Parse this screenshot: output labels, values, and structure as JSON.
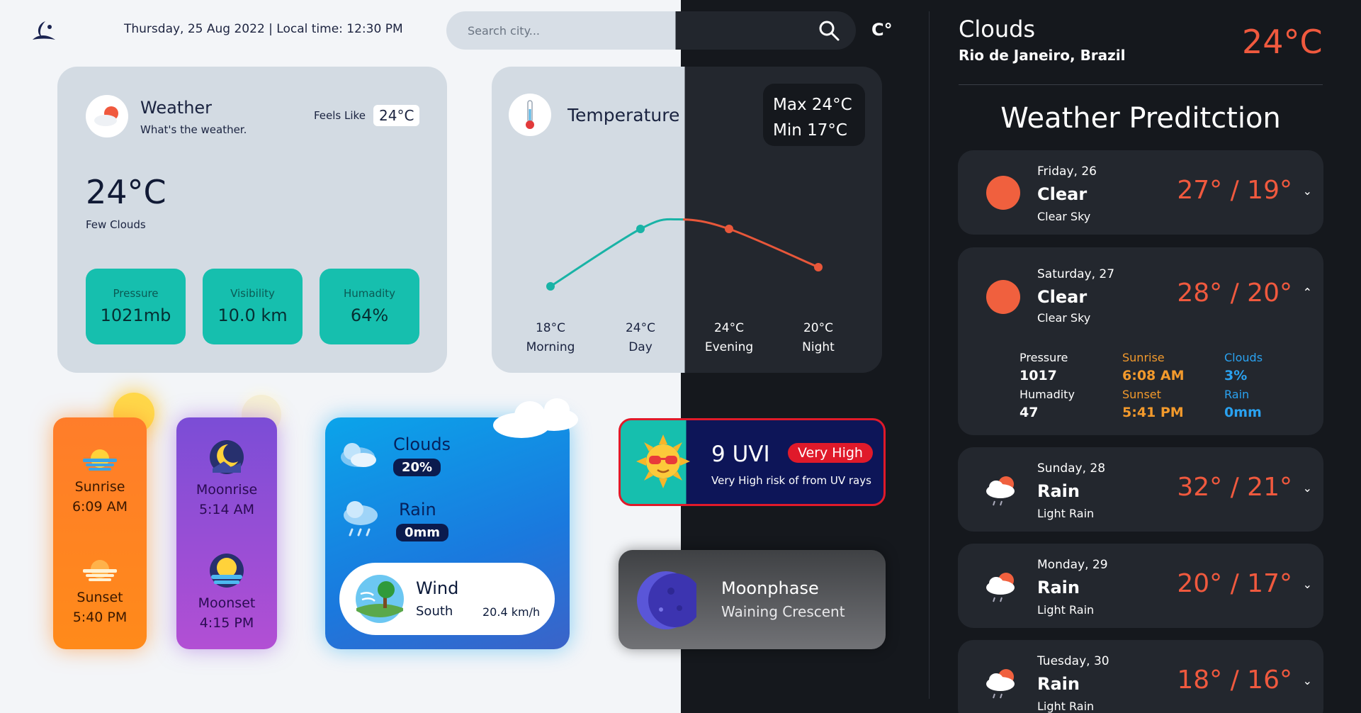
{
  "header": {
    "date_time": "Thursday, 25 Aug 2022 | Local time: 12:30 PM",
    "search_placeholder": "Search city...",
    "unit_toggle": "C°"
  },
  "weather_card": {
    "title": "Weather",
    "subtitle": "What's the weather.",
    "feels_like_label": "Feels Like",
    "feels_like_value": "24°C",
    "temperature": "24°C",
    "description": "Few Clouds",
    "stats": [
      {
        "label": "Pressure",
        "value": "1021mb"
      },
      {
        "label": "Visibility",
        "value": "10.0 km"
      },
      {
        "label": "Humadity",
        "value": "64%"
      }
    ]
  },
  "temperature_card": {
    "title": "Temperature",
    "max": "Max 24°C",
    "min": "Min 17°C",
    "points": [
      {
        "temp_c": 18,
        "label": "18°C",
        "period": "Morning"
      },
      {
        "temp_c": 24,
        "label": "24°C",
        "period": "Day"
      },
      {
        "temp_c": 24,
        "label": "24°C",
        "period": "Evening"
      },
      {
        "temp_c": 20,
        "label": "20°C",
        "period": "Night"
      }
    ],
    "colors": {
      "light_line": "#19b3a6",
      "dark_line": "#e8573a"
    }
  },
  "sun_card": {
    "sunrise_label": "Sunrise",
    "sunrise_time": "6:09 AM",
    "sunset_label": "Sunset",
    "sunset_time": "5:40 PM"
  },
  "moon_card": {
    "moonrise_label": "Moonrise",
    "moonrise_time": "5:14 AM",
    "moonset_label": "Moonset",
    "moonset_time": "4:15 PM"
  },
  "clouds_card": {
    "clouds_label": "Clouds",
    "clouds_value": "20%",
    "rain_label": "Rain",
    "rain_value": "0mm",
    "wind_label": "Wind",
    "wind_direction": "South",
    "wind_speed": "20.4 km/h"
  },
  "uvi_card": {
    "value": "9 UVI",
    "badge": "Very High",
    "description": "Very High risk of from UV rays"
  },
  "moonphase_card": {
    "title": "Moonphase",
    "phase": "Waining Crescent"
  },
  "current": {
    "condition": "Clouds",
    "location": "Rio de Janeiro, Brazil",
    "temperature": "24°C"
  },
  "forecast": {
    "heading": "Weather Preditction",
    "days": [
      {
        "day": "Friday, 26",
        "main": "Clear",
        "sub": "Clear Sky",
        "temps": "27° / 19°",
        "icon": "sun-icon",
        "expanded": false
      },
      {
        "day": "Saturday, 27",
        "main": "Clear",
        "sub": "Clear Sky",
        "temps": "28° / 20°",
        "icon": "sun-icon",
        "expanded": true,
        "details": {
          "pressure_label": "Pressure",
          "pressure": "1017",
          "humidity_label": "Humadity",
          "humidity": "47",
          "sunrise_label": "Sunrise",
          "sunrise": "6:08 AM",
          "sunset_label": "Sunset",
          "sunset": "5:41 PM",
          "clouds_label": "Clouds",
          "clouds": "3%",
          "rain_label": "Rain",
          "rain": "0mm"
        }
      },
      {
        "day": "Sunday, 28",
        "main": "Rain",
        "sub": "Light Rain",
        "temps": "32° / 21°",
        "icon": "rain-cloud-icon",
        "expanded": false
      },
      {
        "day": "Monday, 29",
        "main": "Rain",
        "sub": "Light Rain",
        "temps": "20° / 17°",
        "icon": "rain-cloud-icon",
        "expanded": false
      },
      {
        "day": "Tuesday, 30",
        "main": "Rain",
        "sub": "Light Rain",
        "temps": "18° / 16°",
        "icon": "rain-cloud-icon",
        "expanded": false
      }
    ]
  },
  "colors": {
    "accent_orange": "#f0593e",
    "teal": "#16bfae",
    "dark_bg": "#15181d",
    "card_dark": "#23272e",
    "light_bg": "#f3f5f8",
    "card_light": "#d3dbe3"
  }
}
